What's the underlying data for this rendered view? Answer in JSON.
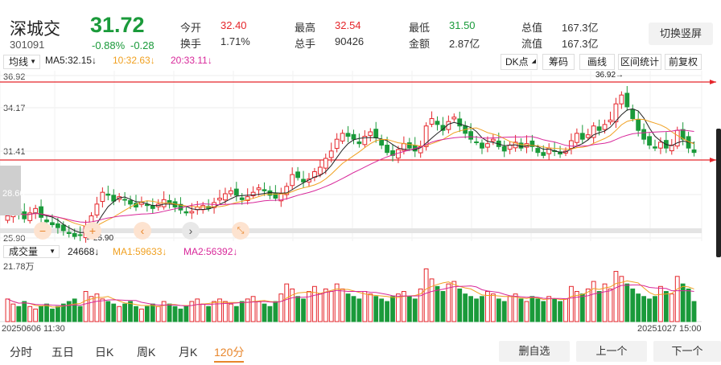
{
  "stock": {
    "name": "深城交",
    "code": "301091",
    "price": "31.72",
    "change_pct": "-0.88%",
    "change": "-0.28"
  },
  "quote": [
    {
      "label": "今开",
      "value": "32.40",
      "color": "#e5262b"
    },
    {
      "label": "换手",
      "value": "1.71%",
      "color": "#333333"
    },
    {
      "label": "最高",
      "value": "32.54",
      "color": "#e5262b"
    },
    {
      "label": "总手",
      "value": "90426",
      "color": "#333333"
    },
    {
      "label": "最低",
      "value": "31.50",
      "color": "#1a9a3a"
    },
    {
      "label": "金额",
      "value": "2.87亿",
      "color": "#333333"
    },
    {
      "label": "总值",
      "value": "167.3亿",
      "color": "#333333"
    },
    {
      "label": "流值",
      "value": "167.3亿",
      "color": "#333333"
    }
  ],
  "switch_label": "切换竖屏",
  "toolbar": {
    "ma_select": "均线",
    "ma5": "MA5:32.15",
    "ma10": "10:32.63",
    "ma20": "20:33.11",
    "dk_label": "DK点",
    "chip_label": "筹码",
    "draw_label": "画线",
    "range_label": "区间统计",
    "adjust_label": "前复权"
  },
  "price_axis": {
    "max": "36.92",
    "mid1": "34.17",
    "mid2": "31.41",
    "low_hidden": "28.66",
    "min": "25.90"
  },
  "annotations": {
    "high_mark": "36.92",
    "low_mark": "25.90"
  },
  "nav_icons": [
    "minus-icon",
    "plus-icon",
    "chevron-left-icon",
    "chevron-right-icon",
    "collapse-icon"
  ],
  "volume": {
    "select": "成交量",
    "vol_label": "24668",
    "ma1": "MA1:59633",
    "ma2": "MA2:56392",
    "axis_max": "21.78万"
  },
  "dates": {
    "start": "20250606 11:30",
    "end": "20251027 15:00"
  },
  "tabs": [
    "分时",
    "五日",
    "日K",
    "周K",
    "月K",
    "120分"
  ],
  "active_tab": "120分",
  "buttons": {
    "remove": "删自选",
    "prev": "上一个",
    "next": "下一个"
  },
  "colors": {
    "up": "#e5262b",
    "down": "#1a9a3a",
    "ma5": "#222222",
    "ma10": "#f0a020",
    "ma20": "#d8289a",
    "accent": "#e8862b"
  },
  "chart_data": {
    "type": "candlestick",
    "ylim": [
      25.9,
      36.92
    ],
    "close": [
      27.4,
      27.8,
      27.5,
      27.2,
      27.6,
      27.9,
      27.3,
      27.0,
      26.8,
      26.6,
      26.4,
      26.2,
      26.0,
      26.1,
      26.7,
      27.4,
      28.2,
      29.0,
      28.8,
      28.4,
      28.7,
      28.5,
      28.2,
      28.0,
      28.3,
      28.1,
      27.9,
      28.2,
      28.5,
      28.3,
      28.0,
      27.8,
      27.6,
      27.7,
      28.0,
      28.1,
      27.9,
      28.3,
      28.6,
      28.9,
      29.1,
      28.8,
      28.5,
      28.7,
      29.0,
      29.3,
      29.1,
      28.8,
      28.6,
      28.9,
      29.4,
      30.2,
      30.0,
      29.7,
      29.9,
      30.4,
      30.7,
      31.3,
      31.8,
      32.6,
      33.0,
      32.8,
      32.6,
      32.3,
      32.8,
      33.1,
      32.7,
      32.2,
      31.7,
      31.5,
      31.9,
      32.3,
      32.0,
      31.8,
      32.1,
      33.5,
      34.0,
      33.6,
      33.2,
      33.8,
      34.1,
      33.5,
      33.0,
      32.6,
      32.4,
      32.0,
      32.3,
      32.6,
      32.1,
      31.8,
      32.2,
      32.4,
      32.0,
      32.3,
      32.1,
      31.7,
      31.5,
      32.0,
      31.8,
      31.6,
      31.8,
      32.5,
      33.0,
      32.6,
      32.9,
      33.5,
      33.2,
      33.6,
      33.9,
      35.0,
      35.6,
      34.8,
      34.0,
      33.2,
      32.6,
      32.2,
      32.0,
      32.4,
      32.0,
      32.2,
      33.2,
      32.6,
      32.0,
      31.7
    ],
    "volume": [
      9,
      7,
      6,
      8,
      6,
      5,
      6,
      7,
      5,
      6,
      7,
      8,
      9,
      6,
      12,
      10,
      11,
      9,
      8,
      7,
      6,
      7,
      8,
      6,
      5,
      6,
      7,
      6,
      8,
      7,
      6,
      5,
      6,
      8,
      9,
      7,
      6,
      8,
      9,
      8,
      7,
      6,
      8,
      9,
      10,
      8,
      7,
      6,
      8,
      11,
      15,
      13,
      10,
      9,
      12,
      14,
      11,
      13,
      12,
      15,
      13,
      11,
      10,
      9,
      12,
      11,
      10,
      9,
      8,
      10,
      11,
      12,
      10,
      9,
      13,
      21,
      17,
      14,
      12,
      15,
      16,
      13,
      11,
      10,
      9,
      10,
      12,
      11,
      9,
      8,
      10,
      11,
      9,
      8,
      10,
      9,
      8,
      10,
      9,
      8,
      9,
      14,
      12,
      11,
      13,
      16,
      12,
      15,
      13,
      20,
      18,
      15,
      13,
      11,
      10,
      9,
      10,
      14,
      12,
      11,
      18,
      15,
      13,
      8
    ]
  }
}
